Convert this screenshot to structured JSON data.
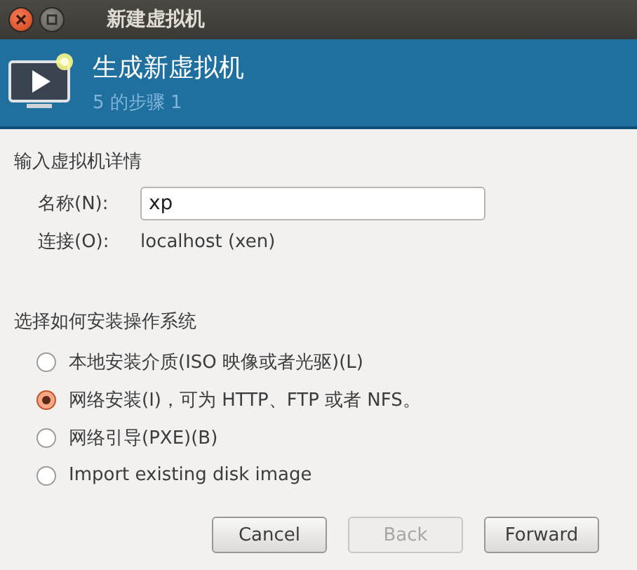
{
  "window": {
    "title": "新建虚拟机",
    "buttons": [
      {
        "kind": "close"
      },
      {
        "kind": "maximize"
      }
    ]
  },
  "header": {
    "title": "生成新虚拟机",
    "subtitle": "5 的步骤 1"
  },
  "details": {
    "heading": "输入虚拟机详情",
    "fields": [
      {
        "kind": "input",
        "label": "名称(N):",
        "value": "xp"
      },
      {
        "kind": "text",
        "label": "连接(O):",
        "value": "localhost (xen)"
      }
    ]
  },
  "install": {
    "heading": "选择如何安装操作系统",
    "options": [
      {
        "label": "本地安装介质(ISO 映像或者光驱)(L)",
        "selected": false
      },
      {
        "label": "网络安装(I)，可为 HTTP、FTP 或者 NFS。",
        "selected": true
      },
      {
        "label": "网络引导(PXE)(B)",
        "selected": false
      },
      {
        "label": "Import existing disk image",
        "selected": false
      }
    ]
  },
  "buttons": [
    {
      "label": "Cancel",
      "disabled": false
    },
    {
      "label": "Back",
      "disabled": true
    },
    {
      "label": "Forward",
      "disabled": false
    }
  ]
}
